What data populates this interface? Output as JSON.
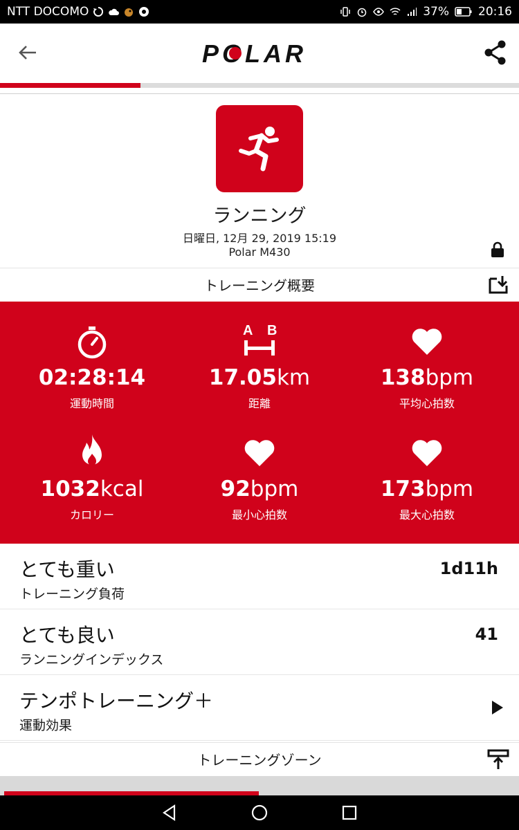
{
  "status_bar": {
    "carrier": "NTT DOCOMO",
    "battery": "37%",
    "time": "20:16"
  },
  "app": {
    "logo_text": "POLAR",
    "progress": 0.27
  },
  "session": {
    "sport": "ランニング",
    "datetime": "日曜日, 12月 29, 2019 15:19",
    "device": "Polar M430"
  },
  "overview": {
    "title": "トレーニング概要"
  },
  "stats": [
    {
      "value": "02:28:14",
      "unit": "",
      "label": "運動時間",
      "icon": "stopwatch-icon"
    },
    {
      "value": "17.05",
      "unit": "km",
      "label": "距離",
      "icon": "distance-icon",
      "icon_a": "A",
      "icon_b": "B"
    },
    {
      "value": "138",
      "unit": "bpm",
      "label": "平均心拍数",
      "icon": "heart-icon"
    },
    {
      "value": "1032",
      "unit": "kcal",
      "label": "カロリー",
      "icon": "flame-icon"
    },
    {
      "value": "92",
      "unit": "bpm",
      "label": "最小心拍数",
      "icon": "heart-icon"
    },
    {
      "value": "173",
      "unit": "bpm",
      "label": "最大心拍数",
      "icon": "heart-icon"
    }
  ],
  "rows": [
    {
      "title": "とても重い",
      "sub": "トレーニング負荷",
      "value": "1d11h"
    },
    {
      "title": "とても良い",
      "sub": "ランニングインデックス",
      "value": "41"
    },
    {
      "title": "テンポトレーニング＋",
      "sub": "運動効果",
      "value": ""
    }
  ],
  "zones": {
    "title": "トレーニングゾーン",
    "progress": 0.49
  },
  "colors": {
    "accent": "#d0021b",
    "background": "#ffffff",
    "nav": "#000000"
  }
}
